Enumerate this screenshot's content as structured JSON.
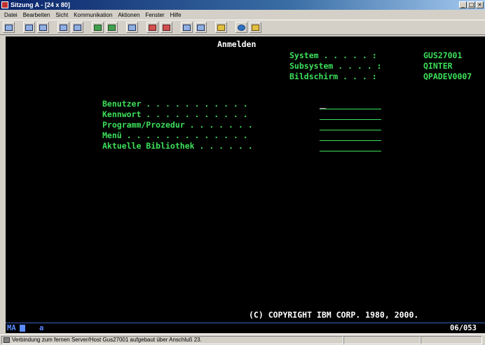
{
  "window": {
    "title": "Sitzung A - [24 x 80]",
    "controls": {
      "minimize": "_",
      "maximize": "□",
      "close": "×"
    }
  },
  "menu": [
    "Datei",
    "Bearbeiten",
    "Sicht",
    "Kommunikation",
    "Aktionen",
    "Fenster",
    "Hilfe"
  ],
  "toolbar": {
    "buttons": [
      "screen-icon",
      "copy-icon",
      "paste-icon",
      "send-icon",
      "receive-icon",
      "display-icon",
      "session-icon",
      "keypad-icon",
      "record-icon",
      "play-icon",
      "macro-icon",
      "macro-run-icon",
      "printer-icon",
      "globe-icon",
      "edit-icon"
    ]
  },
  "screen": {
    "title": "Anmelden",
    "system_label": "System . . . . . :",
    "system_value": "GUS27001",
    "subsystem_label": "Subsystem . . . . :",
    "subsystem_value": "QINTER",
    "display_label": "Bildschirm . . . :",
    "display_value": "QPADEV0007",
    "fields": [
      {
        "label": "Benutzer . . . . . . . . . . .",
        "value": ""
      },
      {
        "label": "Kennwort . . . . . . . . . . .",
        "value": ""
      },
      {
        "label": "Programm/Prozedur . . . . . . .",
        "value": ""
      },
      {
        "label": "Menü . . . . . . . . . . . . .",
        "value": ""
      },
      {
        "label": "Aktuelle Bibliothek . . . . . .",
        "value": ""
      }
    ],
    "copyright": "(C) COPYRIGHT IBM CORP. 1980, 2000."
  },
  "oia": {
    "mode": "MA",
    "indicator": "a",
    "cursor_position": "06/053"
  },
  "statusbar": {
    "message": "Verbindung zum fernen Server/Host Gus27001 aufgebaut über Anschluß 23."
  },
  "colors": {
    "terminal_green": "#3ce05a",
    "terminal_white": "#ffffff",
    "terminal_background": "#000000",
    "oia_blue": "#5a8aff"
  }
}
